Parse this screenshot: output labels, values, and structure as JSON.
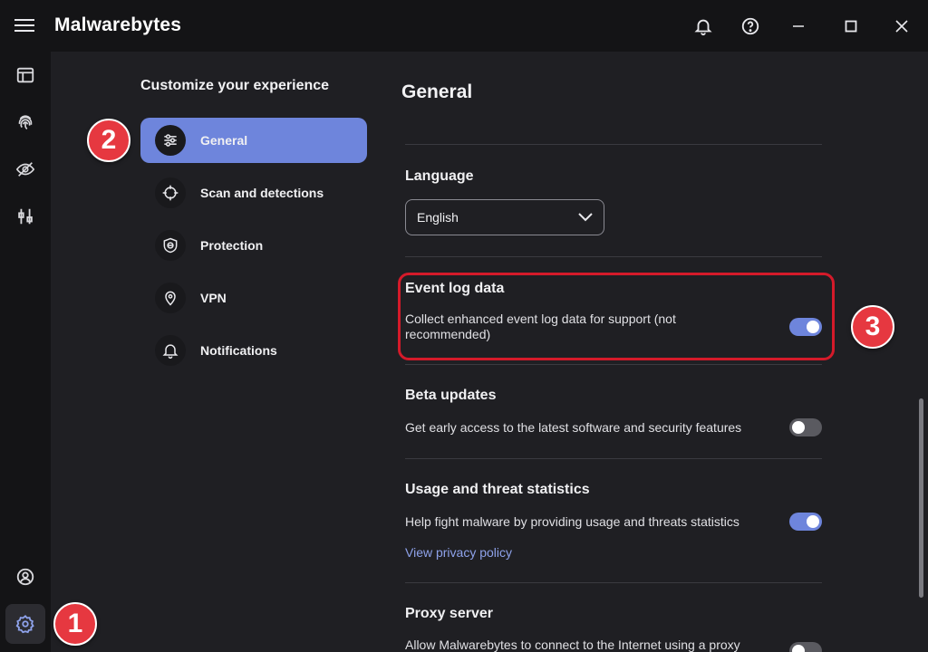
{
  "app": {
    "logo_bold": "M",
    "logo_rest": "alwarebytes"
  },
  "menu": {
    "title": "Customize your experience",
    "items": [
      {
        "label": "General",
        "icon": "sliders-icon",
        "active": true
      },
      {
        "label": "Scan and detections",
        "icon": "crosshair-icon",
        "active": false
      },
      {
        "label": "Protection",
        "icon": "shield-icon",
        "active": false
      },
      {
        "label": "VPN",
        "icon": "location-pin-icon",
        "active": false
      },
      {
        "label": "Notifications",
        "icon": "bell-icon",
        "active": false
      }
    ]
  },
  "main": {
    "title": "General",
    "language": {
      "title": "Language",
      "value": "English"
    },
    "event_log": {
      "title": "Event log data",
      "desc": "Collect enhanced event log data for support (not recommended)",
      "enabled": true
    },
    "beta": {
      "title": "Beta updates",
      "desc": "Get early access to the latest software and security features",
      "enabled": false
    },
    "usage": {
      "title": "Usage and threat statistics",
      "desc": "Help fight malware by providing usage and threats statistics",
      "enabled": true,
      "link": "View privacy policy"
    },
    "proxy": {
      "title": "Proxy server",
      "desc": "Allow Malwarebytes to connect to the Internet using a proxy",
      "enabled": false
    }
  },
  "annotations": {
    "one": "1",
    "two": "2",
    "three": "3"
  },
  "colors": {
    "accent": "#6e85dc",
    "highlight": "#d41a2a",
    "badge": "#e63840"
  }
}
